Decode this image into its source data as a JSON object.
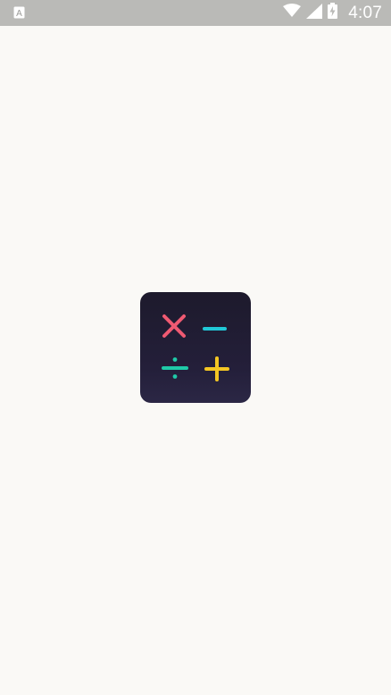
{
  "status_bar": {
    "time": "4:07",
    "icons": [
      "notification-a-icon",
      "wifi-icon",
      "cellular-signal-icon",
      "battery-charging-icon"
    ]
  },
  "splash": {
    "logo_icons": [
      "multiply-icon",
      "minus-icon",
      "divide-icon",
      "plus-icon"
    ],
    "colors": {
      "background": "#faf9f6",
      "logo_background": "#221d35",
      "multiply": "#ef5a72",
      "minus": "#21c7d6",
      "divide": "#1fcaa8",
      "plus": "#f4c623"
    }
  }
}
